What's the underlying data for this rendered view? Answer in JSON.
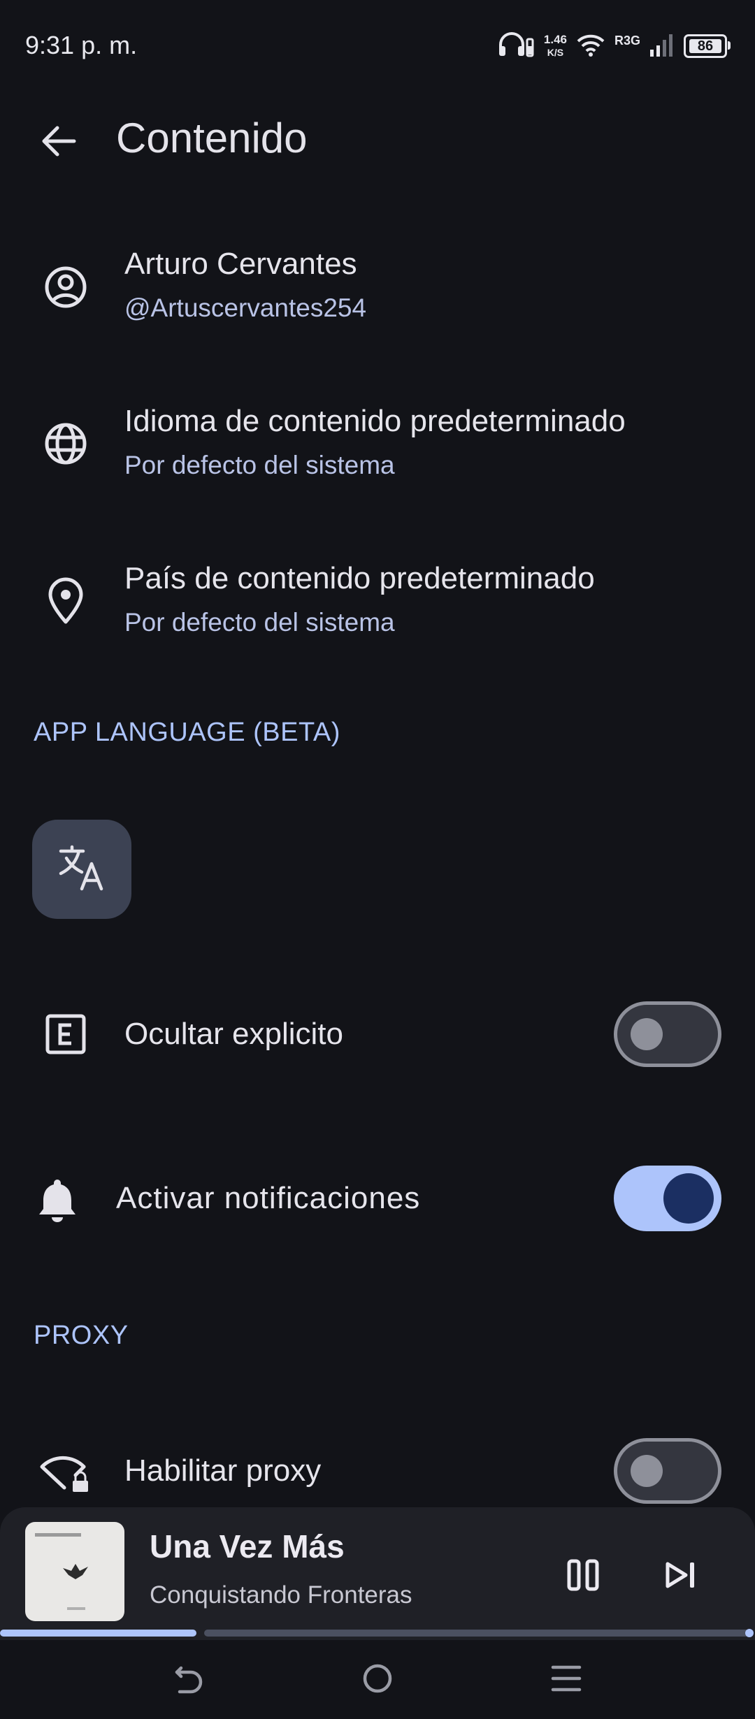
{
  "status_bar": {
    "time": "9:31 p. m.",
    "net_speed_value": "1.46",
    "net_speed_unit": "K/S",
    "network_label": "R3G",
    "battery": "86"
  },
  "app_bar": {
    "title": "Contenido"
  },
  "rows": {
    "account": {
      "title": "Arturo Cervantes",
      "subtitle": "@Artuscervantes254",
      "icon": "account-circle-icon"
    },
    "language": {
      "title": "Idioma de contenido predeterminado",
      "subtitle": "Por defecto del sistema",
      "icon": "globe-icon"
    },
    "country": {
      "title": "País de contenido predeterminado",
      "subtitle": "Por defecto del sistema",
      "icon": "location-pin-icon"
    }
  },
  "sections": {
    "app_language": "APP LANGUAGE (BETA)",
    "proxy": "PROXY"
  },
  "toggles": {
    "hide_explicit": {
      "label": "Ocultar explicito",
      "enabled": false,
      "icon": "explicit-icon"
    },
    "notifications": {
      "label": "Activar notificaciones",
      "enabled": true,
      "icon": "bell-icon"
    },
    "proxy": {
      "label": "Habilitar proxy",
      "enabled": false,
      "icon": "wifi-lock-icon"
    }
  },
  "player": {
    "title": "Una Vez Más",
    "artist": "Conquistando Fronteras",
    "progress": 0.26
  },
  "colors": {
    "background": "#121318",
    "accent": "#adc4fb",
    "player_background": "#1f2026"
  }
}
